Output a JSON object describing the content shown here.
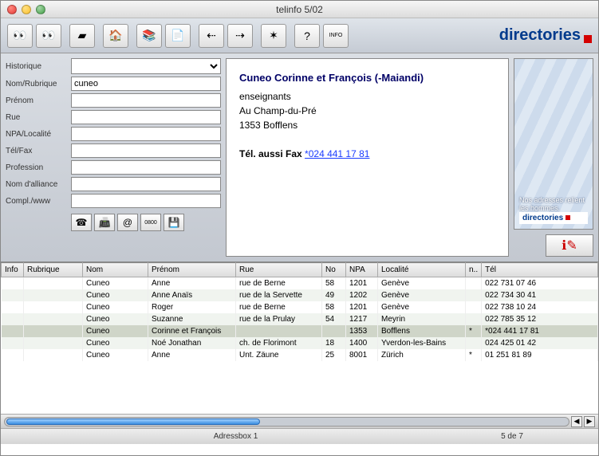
{
  "window": {
    "title": "telinfo 5/02"
  },
  "brand": "directories",
  "toolbar": [
    {
      "name": "binoculars-icon",
      "glyph": "👀"
    },
    {
      "name": "binoculars-red-icon",
      "glyph": "👀"
    },
    {
      "name": "eraser-icon",
      "glyph": "▰"
    },
    {
      "name": "house-grid-icon",
      "glyph": "🏠"
    },
    {
      "name": "stack-icon",
      "glyph": "📚"
    },
    {
      "name": "copy-icon",
      "glyph": "📄"
    },
    {
      "name": "export-left-icon",
      "glyph": "⇠"
    },
    {
      "name": "export-right-icon",
      "glyph": "⇢"
    },
    {
      "name": "bug-icon",
      "glyph": "✶"
    },
    {
      "name": "help-icon",
      "glyph": "?"
    },
    {
      "name": "info-icon",
      "glyph": "INFO"
    }
  ],
  "form": {
    "labels": {
      "historique": "Historique",
      "nom": "Nom/Rubrique",
      "prenom": "Prénom",
      "rue": "Rue",
      "npa": "NPA/Localité",
      "tel": "Tél/Fax",
      "profession": "Profession",
      "alliance": "Nom d'alliance",
      "compl": "Compl./www"
    },
    "values": {
      "historique": "",
      "nom": "cuneo",
      "prenom": "",
      "rue": "",
      "npa": "",
      "tel": "",
      "profession": "",
      "alliance": "",
      "compl": ""
    },
    "mini_icons": [
      {
        "name": "phone-icon",
        "glyph": "☎"
      },
      {
        "name": "fax-icon",
        "glyph": "📠"
      },
      {
        "name": "at-icon",
        "glyph": "@"
      },
      {
        "name": "freecall-icon",
        "glyph": "0800"
      },
      {
        "name": "disk-icon",
        "glyph": "💾"
      }
    ]
  },
  "detail": {
    "name": "Cuneo Corinne et François (-Maiandi)",
    "profession": "enseignants",
    "street": "Au Champ-du-Pré",
    "city": "1353 Bofflens",
    "phone_label": "Tél. aussi Fax ",
    "phone": "*024 441 17 81"
  },
  "ad": {
    "tagline": "Nos adresses relient les hommes.",
    "brand": "directories"
  },
  "table": {
    "headers": [
      "Info",
      "Rubrique",
      "Nom",
      "Prénom",
      "Rue",
      "No",
      "NPA",
      "Localité",
      "n..",
      "Tél"
    ],
    "rows": [
      {
        "info": "",
        "rub": "",
        "nom": "Cuneo",
        "pre": "Anne",
        "rue": "rue de Berne",
        "no": "58",
        "npa": "1201",
        "loc": "Genève",
        "n": "",
        "tel": "022 731 07 46"
      },
      {
        "info": "",
        "rub": "",
        "nom": "Cuneo",
        "pre": "Anne Anaïs",
        "rue": "rue de la Servette",
        "no": "49",
        "npa": "1202",
        "loc": "Genève",
        "n": "",
        "tel": "022 734 30 41"
      },
      {
        "info": "",
        "rub": "",
        "nom": "Cuneo",
        "pre": "Roger",
        "rue": "rue de Berne",
        "no": "58",
        "npa": "1201",
        "loc": "Genève",
        "n": "",
        "tel": "022 738 10 24"
      },
      {
        "info": "",
        "rub": "",
        "nom": "Cuneo",
        "pre": "Suzanne",
        "rue": "rue de la Prulay",
        "no": "54",
        "npa": "1217",
        "loc": "Meyrin",
        "n": "",
        "tel": "022 785 35 12"
      },
      {
        "info": "",
        "rub": "",
        "nom": "Cuneo",
        "pre": "Corinne et François",
        "rue": "",
        "no": "",
        "npa": "1353",
        "loc": "Bofflens",
        "n": "*",
        "tel": "*024 441 17 81",
        "selected": true
      },
      {
        "info": "",
        "rub": "",
        "nom": "Cuneo",
        "pre": "Noé Jonathan",
        "rue": "ch. de Florimont",
        "no": "18",
        "npa": "1400",
        "loc": "Yverdon-les-Bains",
        "n": "",
        "tel": "024 425 01 42"
      },
      {
        "info": "",
        "rub": "",
        "nom": "Cuneo",
        "pre": "Anne",
        "rue": "Unt. Zäune",
        "no": "25",
        "npa": "8001",
        "loc": "Zürich",
        "n": "*",
        "tel": "01 251 81 89"
      }
    ]
  },
  "status": {
    "box": "Adressbox 1",
    "count": "5 de 7"
  }
}
